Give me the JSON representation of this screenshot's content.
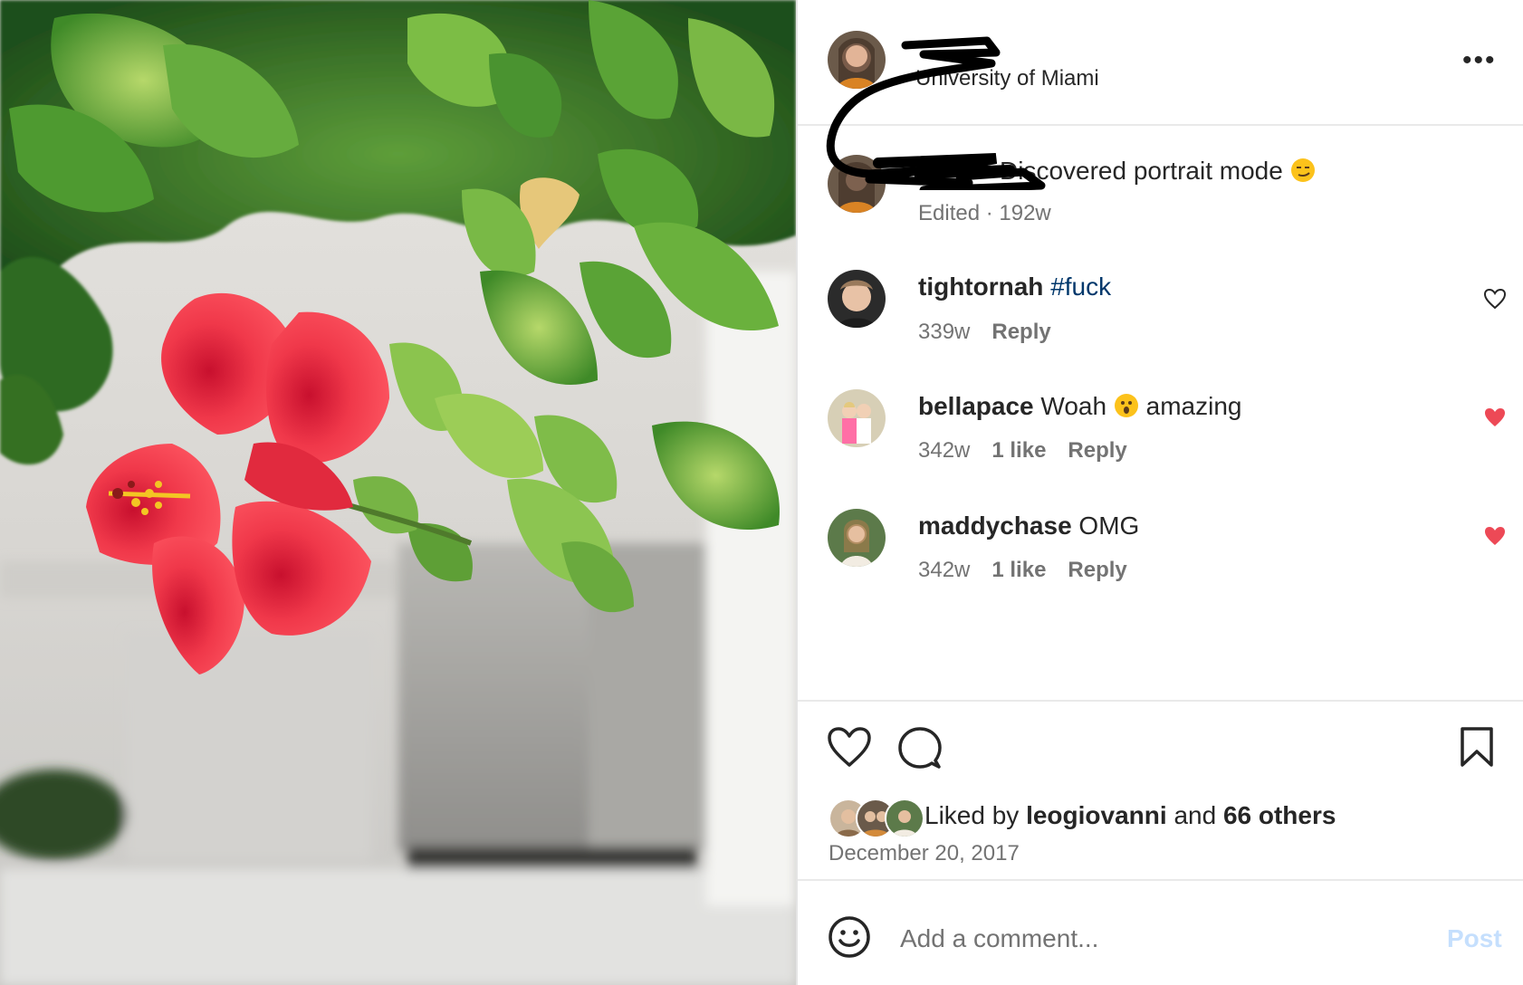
{
  "post": {
    "location": "University of Miami",
    "more_label": "•••",
    "caption": {
      "text": "Discovered portrait mode",
      "emoji": "smirking-face-emoji",
      "meta": "Edited · 192w"
    }
  },
  "comments": [
    {
      "username": "tightornah",
      "text": "#fuck",
      "time": "339w",
      "likes": "",
      "reply": "Reply",
      "liked": false
    },
    {
      "username": "bellapace",
      "text_before": "Woah",
      "emoji": "hushed-face-emoji",
      "text_after": "amazing",
      "time": "342w",
      "likes": "1 like",
      "reply": "Reply",
      "liked": true
    },
    {
      "username": "maddychase",
      "text": "OMG",
      "time": "342w",
      "likes": "1 like",
      "reply": "Reply",
      "liked": true
    }
  ],
  "likes": {
    "prefix": "Liked by",
    "user": "leogiovanni",
    "conj": "and",
    "others": "66 others"
  },
  "date": "December 20, 2017",
  "composer": {
    "placeholder": "Add a comment...",
    "post_label": "Post"
  },
  "colors": {
    "liked_heart": "#ed4956",
    "hashtag": "#00376b",
    "post_disabled": "#c5dffd",
    "secondary_text": "#737373"
  }
}
